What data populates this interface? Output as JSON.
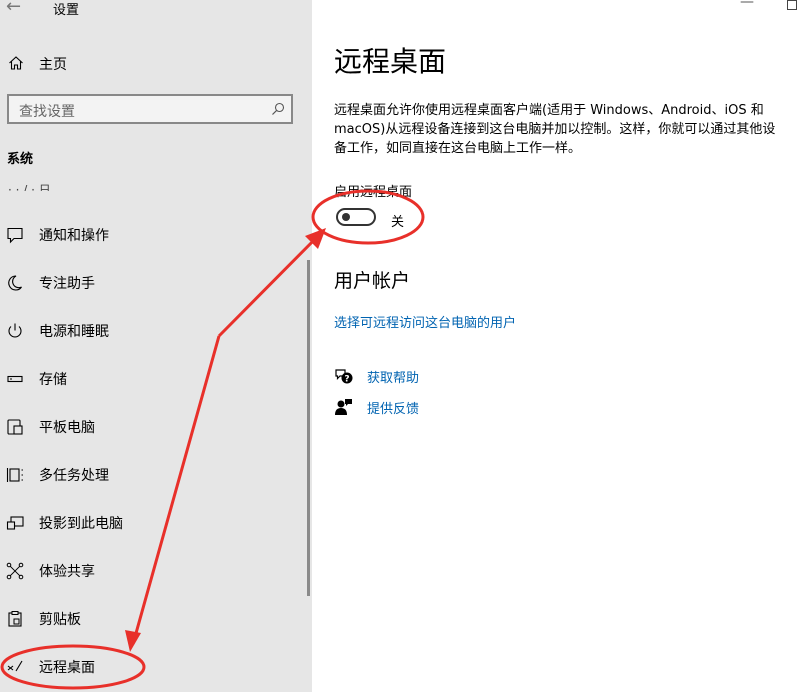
{
  "window": {
    "title": "设置",
    "back_icon": "←",
    "minimize_icon": "—"
  },
  "sidebar": {
    "home_label": "主页",
    "search_placeholder": "查找设置",
    "section_title": "系统",
    "clipped_item": "· · / · 日",
    "items": [
      {
        "icon": "notifications-icon",
        "label": "通知和操作"
      },
      {
        "icon": "focus-assist-icon",
        "label": "专注助手"
      },
      {
        "icon": "power-icon",
        "label": "电源和睡眠"
      },
      {
        "icon": "storage-icon",
        "label": "存储"
      },
      {
        "icon": "tablet-icon",
        "label": "平板电脑"
      },
      {
        "icon": "multitasking-icon",
        "label": "多任务处理"
      },
      {
        "icon": "project-icon",
        "label": "投影到此电脑"
      },
      {
        "icon": "shared-experiences-icon",
        "label": "体验共享"
      },
      {
        "icon": "clipboard-icon",
        "label": "剪贴板"
      },
      {
        "icon": "remote-desktop-icon",
        "label": "远程桌面"
      }
    ]
  },
  "main": {
    "title": "远程桌面",
    "description": "远程桌面允许你使用远程桌面客户端(适用于 Windows、Android、iOS 和 macOS)从远程设备连接到这台电脑并加以控制。这样，你就可以通过其他设备工作，如同直接在这台电脑上工作一样。",
    "toggle_label": "启用远程桌面",
    "toggle_state": "关",
    "toggle_on": false,
    "user_accounts_title": "用户帐户",
    "select_users_link": "选择可远程访问这台电脑的用户",
    "help_link": "获取帮助",
    "feedback_link": "提供反馈"
  },
  "annotation": {
    "color": "#e8302a"
  }
}
